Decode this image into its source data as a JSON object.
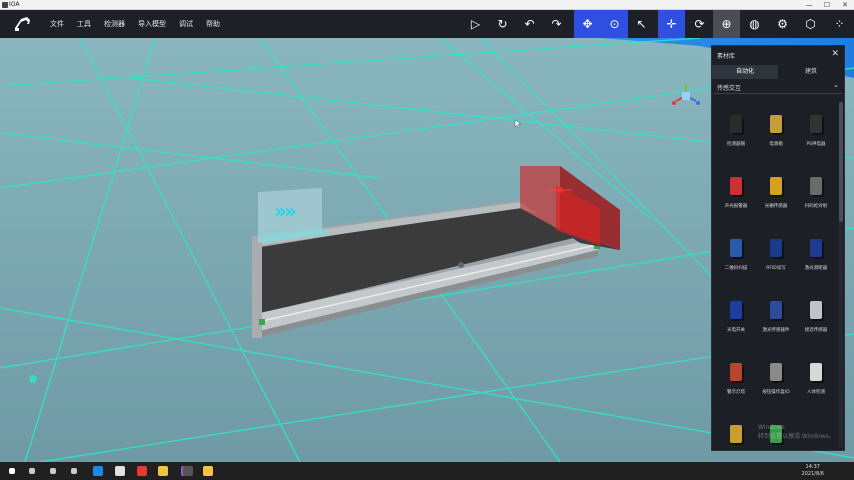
{
  "os_window": {
    "title": "IOA",
    "min": "—",
    "max": "☐",
    "close": "✕"
  },
  "toolbar": {
    "logo_icon": "robot-arm-icon",
    "menu": [
      "文件",
      "工具",
      "检测器",
      "导入模型",
      "调试",
      "帮助"
    ],
    "buttons": [
      {
        "name": "play-icon",
        "glyph": "▷"
      },
      {
        "name": "refresh-icon",
        "glyph": "↻"
      },
      {
        "name": "undo-icon",
        "glyph": "↶"
      },
      {
        "name": "redo-icon",
        "glyph": "↷"
      },
      {
        "name": "select-icon",
        "glyph": "✥"
      },
      {
        "name": "camera-icon",
        "glyph": "⊙"
      },
      {
        "name": "pointer-icon",
        "glyph": "↖"
      },
      {
        "name": "move-icon",
        "glyph": "✛"
      },
      {
        "name": "rotate-icon",
        "glyph": "⟳"
      },
      {
        "name": "pivot-icon",
        "glyph": "⊕"
      },
      {
        "name": "globe-icon",
        "glyph": "◍"
      },
      {
        "name": "settings-icon",
        "glyph": "⚙"
      },
      {
        "name": "cube-icon",
        "glyph": "⬡"
      },
      {
        "name": "grid-icon",
        "glyph": "⁘"
      }
    ],
    "accent": "#2f4fe0"
  },
  "panel": {
    "title": "素材库",
    "close": "✕",
    "tabs": [
      "自动化",
      "建筑"
    ],
    "category": "传感交互",
    "category_chevron": "⌄",
    "items": [
      {
        "label": "检测器钢",
        "icon": "black-post-sensor-icon"
      },
      {
        "label": "电源箱",
        "icon": "gear-box-icon"
      },
      {
        "label": "PS供电器",
        "icon": "power-supply-icon"
      },
      {
        "label": "声光报警器",
        "icon": "alarm-light-icon"
      },
      {
        "label": "光栅传感器",
        "icon": "light-curtain-icon"
      },
      {
        "label": "扫码枪对射",
        "icon": "scanner-icon"
      },
      {
        "label": "二维码扫描",
        "icon": "qr-scanner-icon"
      },
      {
        "label": "RFID读写",
        "icon": "rfid-reader-icon"
      },
      {
        "label": "激光测距器",
        "icon": "laser-meter-icon"
      },
      {
        "label": "光电开关",
        "icon": "photo-switch-icon"
      },
      {
        "label": "激光传感器件",
        "icon": "laser-sensor-icon"
      },
      {
        "label": "接近传感器",
        "icon": "proximity-sensor-icon"
      },
      {
        "label": "警示灯塔",
        "icon": "signal-tower-icon"
      },
      {
        "label": "按钮操作盒IO",
        "icon": "button-box-icon"
      },
      {
        "label": "人体检测",
        "icon": "human-sensor-icon"
      },
      {
        "label": "",
        "icon": "motor-icon"
      },
      {
        "label": "",
        "icon": "module-icon"
      }
    ],
    "watermark": "Windows\n转到设置以激活 Windows。"
  },
  "taskbar": {
    "icons": [
      "windows-start-icon",
      "search-icon",
      "cortana-icon",
      "task-view-icon",
      "edge-icon",
      "store-icon",
      "chrome-icon",
      "file-explorer-icon",
      "visual-studio-icon",
      "app-icon",
      "folder-icon"
    ],
    "time": "14:37",
    "date": "2021/8/6"
  }
}
